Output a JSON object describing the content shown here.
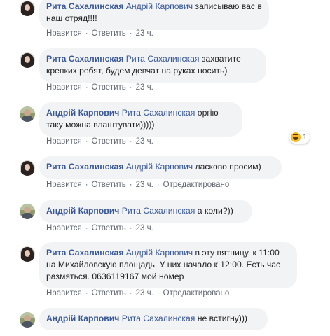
{
  "comments": [
    {
      "author": "Рита Сахалинская",
      "mention": "Андрій Карпович",
      "text": " записываю вас в наш отряд!!!!",
      "actions": {
        "like": "Нравится",
        "reply": "Ответить",
        "time": "23 ч."
      }
    },
    {
      "author": "Рита Сахалинская",
      "mention": "Рита Сахалинская",
      "text": " захватите крепких ребят, будем девчат на руках носить)",
      "actions": {
        "like": "Нравится",
        "reply": "Ответить",
        "time": "23 ч."
      }
    },
    {
      "author": "Андрій Карпович",
      "mention": "Рита Сахалинская",
      "text": " оргію таку можна влаштувати)))))",
      "actions": {
        "like": "Нравится",
        "reply": "Ответить",
        "time": "23 ч."
      },
      "reaction": {
        "icon": "haha-emoji-icon",
        "count": "1"
      }
    },
    {
      "author": "Рита Сахалинская",
      "mention": "Андрій Карпович",
      "text": " ласково просим)",
      "actions": {
        "like": "Нравится",
        "reply": "Ответить",
        "time": "23 ч.",
        "edited": "Отредактировано"
      }
    },
    {
      "author": "Андрій Карпович",
      "mention": "Рита Сахалинская",
      "text": " а коли?))",
      "actions": {
        "like": "Нравится",
        "reply": "Ответить",
        "time": "23 ч."
      }
    },
    {
      "author": "Рита Сахалинская",
      "mention": "Андрій Карпович",
      "text": " в эту пятницу, к 11:00 на Михайловскую площадь. У них начало к 12:00. Есть час размяться. 0636119167 мой номер",
      "actions": {
        "like": "Нравится",
        "reply": "Ответить",
        "time": "23 ч.",
        "edited": "Отредактировано"
      }
    },
    {
      "author": "Андрій Карпович",
      "mention": "Рита Сахалинская",
      "text": " не встигну)))",
      "actions": {}
    }
  ]
}
